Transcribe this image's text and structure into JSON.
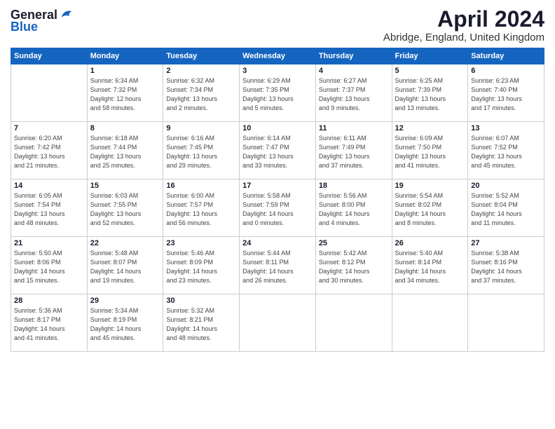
{
  "header": {
    "logo_line1": "General",
    "logo_line2": "Blue",
    "month_title": "April 2024",
    "location": "Abridge, England, United Kingdom"
  },
  "days_of_week": [
    "Sunday",
    "Monday",
    "Tuesday",
    "Wednesday",
    "Thursday",
    "Friday",
    "Saturday"
  ],
  "weeks": [
    [
      {
        "day": "",
        "info": ""
      },
      {
        "day": "1",
        "info": "Sunrise: 6:34 AM\nSunset: 7:32 PM\nDaylight: 12 hours\nand 58 minutes."
      },
      {
        "day": "2",
        "info": "Sunrise: 6:32 AM\nSunset: 7:34 PM\nDaylight: 13 hours\nand 2 minutes."
      },
      {
        "day": "3",
        "info": "Sunrise: 6:29 AM\nSunset: 7:35 PM\nDaylight: 13 hours\nand 5 minutes."
      },
      {
        "day": "4",
        "info": "Sunrise: 6:27 AM\nSunset: 7:37 PM\nDaylight: 13 hours\nand 9 minutes."
      },
      {
        "day": "5",
        "info": "Sunrise: 6:25 AM\nSunset: 7:39 PM\nDaylight: 13 hours\nand 13 minutes."
      },
      {
        "day": "6",
        "info": "Sunrise: 6:23 AM\nSunset: 7:40 PM\nDaylight: 13 hours\nand 17 minutes."
      }
    ],
    [
      {
        "day": "7",
        "info": "Sunrise: 6:20 AM\nSunset: 7:42 PM\nDaylight: 13 hours\nand 21 minutes."
      },
      {
        "day": "8",
        "info": "Sunrise: 6:18 AM\nSunset: 7:44 PM\nDaylight: 13 hours\nand 25 minutes."
      },
      {
        "day": "9",
        "info": "Sunrise: 6:16 AM\nSunset: 7:45 PM\nDaylight: 13 hours\nand 29 minutes."
      },
      {
        "day": "10",
        "info": "Sunrise: 6:14 AM\nSunset: 7:47 PM\nDaylight: 13 hours\nand 33 minutes."
      },
      {
        "day": "11",
        "info": "Sunrise: 6:11 AM\nSunset: 7:49 PM\nDaylight: 13 hours\nand 37 minutes."
      },
      {
        "day": "12",
        "info": "Sunrise: 6:09 AM\nSunset: 7:50 PM\nDaylight: 13 hours\nand 41 minutes."
      },
      {
        "day": "13",
        "info": "Sunrise: 6:07 AM\nSunset: 7:52 PM\nDaylight: 13 hours\nand 45 minutes."
      }
    ],
    [
      {
        "day": "14",
        "info": "Sunrise: 6:05 AM\nSunset: 7:54 PM\nDaylight: 13 hours\nand 48 minutes."
      },
      {
        "day": "15",
        "info": "Sunrise: 6:03 AM\nSunset: 7:55 PM\nDaylight: 13 hours\nand 52 minutes."
      },
      {
        "day": "16",
        "info": "Sunrise: 6:00 AM\nSunset: 7:57 PM\nDaylight: 13 hours\nand 56 minutes."
      },
      {
        "day": "17",
        "info": "Sunrise: 5:58 AM\nSunset: 7:59 PM\nDaylight: 14 hours\nand 0 minutes."
      },
      {
        "day": "18",
        "info": "Sunrise: 5:56 AM\nSunset: 8:00 PM\nDaylight: 14 hours\nand 4 minutes."
      },
      {
        "day": "19",
        "info": "Sunrise: 5:54 AM\nSunset: 8:02 PM\nDaylight: 14 hours\nand 8 minutes."
      },
      {
        "day": "20",
        "info": "Sunrise: 5:52 AM\nSunset: 8:04 PM\nDaylight: 14 hours\nand 11 minutes."
      }
    ],
    [
      {
        "day": "21",
        "info": "Sunrise: 5:50 AM\nSunset: 8:06 PM\nDaylight: 14 hours\nand 15 minutes."
      },
      {
        "day": "22",
        "info": "Sunrise: 5:48 AM\nSunset: 8:07 PM\nDaylight: 14 hours\nand 19 minutes."
      },
      {
        "day": "23",
        "info": "Sunrise: 5:46 AM\nSunset: 8:09 PM\nDaylight: 14 hours\nand 23 minutes."
      },
      {
        "day": "24",
        "info": "Sunrise: 5:44 AM\nSunset: 8:11 PM\nDaylight: 14 hours\nand 26 minutes."
      },
      {
        "day": "25",
        "info": "Sunrise: 5:42 AM\nSunset: 8:12 PM\nDaylight: 14 hours\nand 30 minutes."
      },
      {
        "day": "26",
        "info": "Sunrise: 5:40 AM\nSunset: 8:14 PM\nDaylight: 14 hours\nand 34 minutes."
      },
      {
        "day": "27",
        "info": "Sunrise: 5:38 AM\nSunset: 8:16 PM\nDaylight: 14 hours\nand 37 minutes."
      }
    ],
    [
      {
        "day": "28",
        "info": "Sunrise: 5:36 AM\nSunset: 8:17 PM\nDaylight: 14 hours\nand 41 minutes."
      },
      {
        "day": "29",
        "info": "Sunrise: 5:34 AM\nSunset: 8:19 PM\nDaylight: 14 hours\nand 45 minutes."
      },
      {
        "day": "30",
        "info": "Sunrise: 5:32 AM\nSunset: 8:21 PM\nDaylight: 14 hours\nand 48 minutes."
      },
      {
        "day": "",
        "info": ""
      },
      {
        "day": "",
        "info": ""
      },
      {
        "day": "",
        "info": ""
      },
      {
        "day": "",
        "info": ""
      }
    ]
  ]
}
